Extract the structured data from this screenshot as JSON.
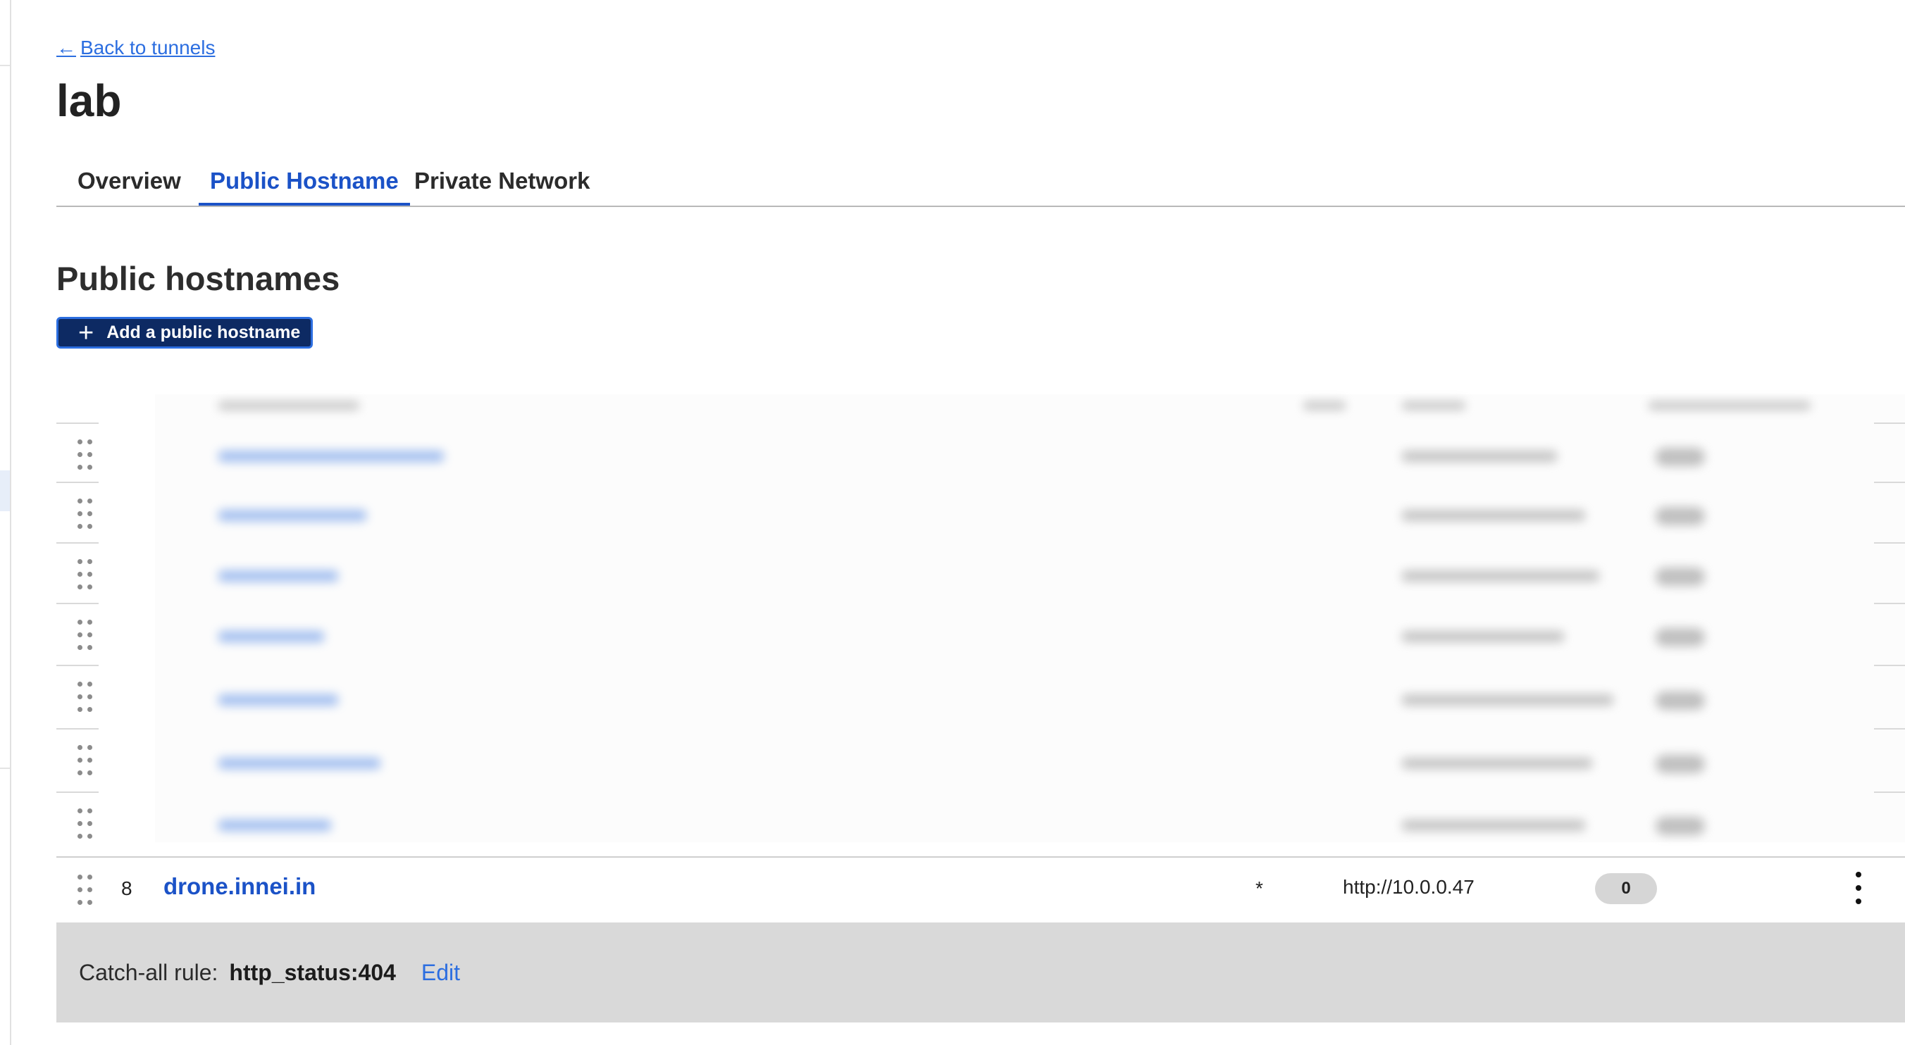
{
  "nav": {
    "back_label": "Back to tunnels",
    "back_arrow": "←"
  },
  "page": {
    "title": "lab"
  },
  "tabs": [
    {
      "label": "Overview",
      "active": false
    },
    {
      "label": "Public Hostname",
      "active": true
    },
    {
      "label": "Private Network",
      "active": false
    }
  ],
  "section": {
    "title": "Public hostnames"
  },
  "actions": {
    "add_label": "Add a public hostname",
    "add_icon": "plus-icon"
  },
  "table": {
    "obscured_row_count": 7,
    "visible_row": {
      "number": "8",
      "hostname": "drone.innei.in",
      "path": "*",
      "service": "http://10.0.0.47",
      "badge": "0"
    }
  },
  "catch_all": {
    "label": "Catch-all rule:",
    "value": "http_status:404",
    "edit_label": "Edit"
  },
  "colors": {
    "accent": "#1b52c7",
    "link": "#2c6ee0",
    "button_bg": "#0d2a63",
    "catch_all_bg": "#d9d9d9"
  }
}
